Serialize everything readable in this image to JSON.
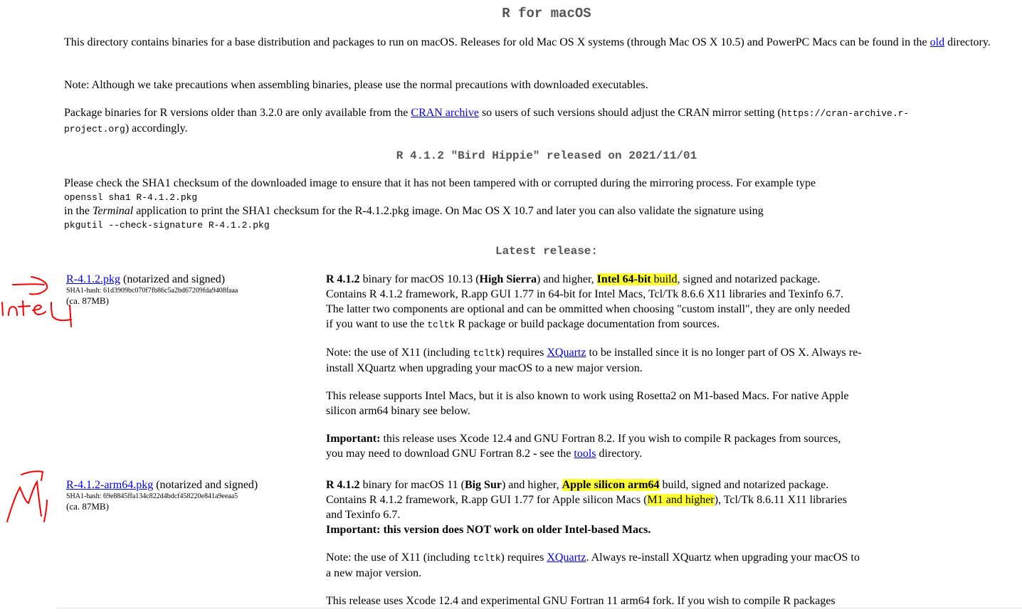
{
  "page": {
    "title": "R for macOS",
    "intro": {
      "text_before": "This directory contains binaries for a base distribution and packages to run on macOS. Releases for old Mac OS X systems (through Mac OS X 10.5) and PowerPC Macs can be found in the ",
      "link": "old",
      "text_after": " directory."
    },
    "note": "Note: Although we take precautions when assembling binaries, please use the normal precautions with downloaded executables.",
    "archive": {
      "text_before": "Package binaries for R versions older than 3.2.0 are only available from the ",
      "link": "CRAN archive",
      "text_middle": " so users of such versions should adjust the CRAN mirror setting (",
      "code_part1": "https://cran-archive.r-",
      "code_part2": "project.org",
      "text_after": ") accordingly."
    },
    "release_heading": "R 4.1.2 \"Bird Hippie\" released on 2021/11/01",
    "checksum": {
      "line1": "Please check the SHA1 checksum of the downloaded image to ensure that it has not been tampered with or corrupted during the mirroring process. For example type",
      "cmd1": "openssl sha1 R-4.1.2.pkg",
      "line2_a": "in the ",
      "line2_em": "Terminal",
      "line2_b": " application to print the SHA1 checksum for the R-4.1.2.pkg image. On Mac OS X 10.7 and later you can also validate the signature using",
      "cmd2": "pkgutil --check-signature R-4.1.2.pkg"
    },
    "latest_heading": "Latest release:"
  },
  "intel": {
    "link": "R-4.1.2.pkg",
    "suffix": " (notarized and signed)",
    "hash": "SHA1-hash: 61d3909bc070f7fb86c5a2bd67209fda9408faaa",
    "size": "(ca. 87MB)",
    "p1": {
      "version": "R 4.1.2",
      "a": " binary for macOS 10.13 (",
      "bold1": "High Sierra",
      "b": ") and higher, ",
      "hl_bold": "Intel 64-bit",
      "hl_plain": " build",
      "c": ", signed and notarized package.",
      "line2": "Contains R 4.1.2 framework, R.app GUI 1.77 in 64-bit for Intel Macs, Tcl/Tk 8.6.6 X11 libraries and Texinfo 6.7.",
      "line3": "The latter two components are optional and can be ommitted when choosing \"custom install\", they are only needed",
      "line4a": "if you want to use the ",
      "line4code": "tcltk",
      "line4b": " R package or build package documentation from sources."
    },
    "p2": {
      "a": "Note: the use of X11 (including ",
      "code": "tcltk",
      "b": ") requires ",
      "link": "XQuartz",
      "c": " to be installed since it is no longer part of OS X. Always re-",
      "line2": "install XQuartz when upgrading your macOS to a new major version."
    },
    "p3": {
      "line1": "This release supports Intel Macs, but it is also known to work using Rosetta2 on M1-based Macs. For native Apple",
      "line2": "silicon arm64 binary see below."
    },
    "p4": {
      "bold": "Important:",
      "a": " this release uses Xcode 12.4 and GNU Fortran 8.2. If you wish to compile R packages from sources,",
      "b": "you may need to download GNU Fortran 8.2 ",
      "dash": "-",
      "c": " see the ",
      "link": "tools",
      "d": " directory."
    }
  },
  "arm": {
    "link": "R-4.1.2-arm64.pkg",
    "suffix": " (notarized and signed)",
    "hash": "SHA1-hash: 69e8845ffa134c822d4bdcf458220e841a9eeaa5",
    "size": "(ca. 87MB)",
    "p1": {
      "version": "R 4.1.2",
      "a": " binary for macOS 11 (",
      "bold1": "Big Sur",
      "b": ") and higher, ",
      "hl_bold": "Apple silicon arm64",
      "c": " build, signed and notarized package.",
      "line2a": "Contains R 4.1.2 framework, R.app GUI 1.77 for Apple silicon Macs (",
      "line2hl": "M1 and higher",
      "line2b": "), Tcl/Tk 8.6.11 X11 libraries",
      "line3": "and Texinfo 6.7.",
      "line4": "Important: this version does NOT work on older Intel-based Macs."
    },
    "p2": {
      "a": "Note: the use of X11 (including ",
      "code": "tcltk",
      "b": ") requires ",
      "link": "XQuartz",
      "c": ". Always re-install XQuartz when upgrading your macOS to",
      "line2": "a new major version."
    },
    "p3": "This release uses Xcode 12.4 and experimental GNU Fortran 11 arm64 fork. If you wish to compile R packages"
  },
  "annotations": {
    "intel_label": "Intel",
    "m1_label": "M1",
    "color": "#ff0000",
    "highlight_color": "#ffff33"
  }
}
